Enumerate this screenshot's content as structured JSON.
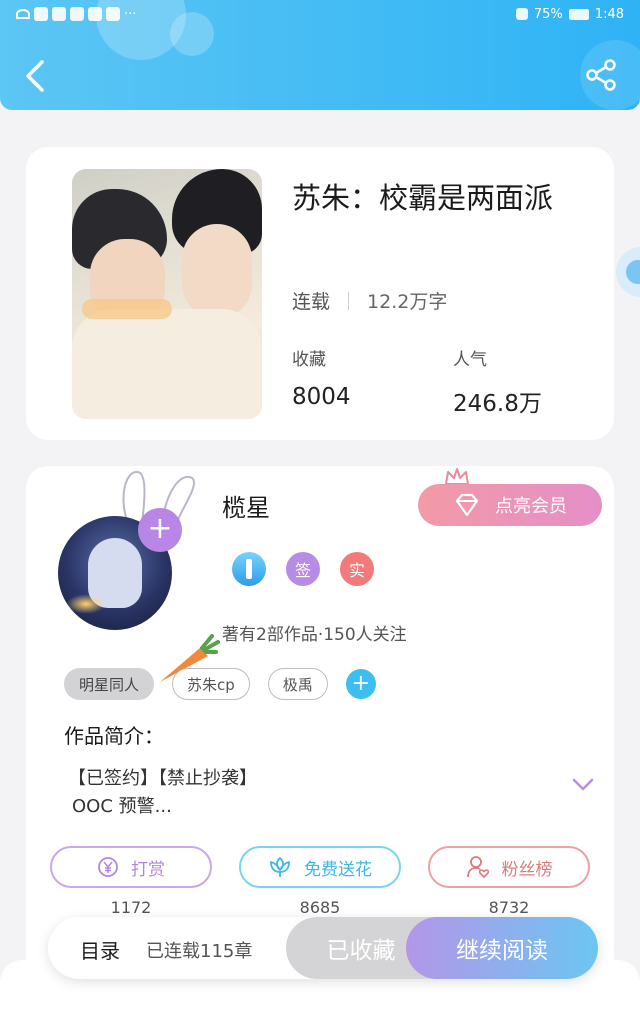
{
  "status_bar": {
    "more": "···",
    "battery": "75%",
    "time": "1:48"
  },
  "book": {
    "title": "苏朱：校霸是两面派",
    "state": "连载",
    "word_count": "12.2万字",
    "favorites_label": "收藏",
    "favorites_value": "8004",
    "popularity_label": "人气",
    "popularity_value": "246.8万"
  },
  "author": {
    "name": "榄星",
    "vip_label": "点亮会员",
    "badge_sign": "签",
    "badge_real": "实",
    "works_info": "著有2部作品·150人关注",
    "tags": [
      "明星同人",
      "苏朱cp",
      "极禹"
    ]
  },
  "intro": {
    "title": "作品简介：",
    "line1": "【已签约】【禁止抄袭】",
    "line2": "OOC 预警..."
  },
  "actions": {
    "reward_label": "打赏",
    "reward_count": "1172",
    "flower_label": "免费送花",
    "flower_count": "8685",
    "fans_label": "粉丝榜",
    "fans_count": "8732"
  },
  "bottom_bar": {
    "toc": "目录",
    "chapters": "已连载115章",
    "collected": "已收藏",
    "continue": "继续阅读"
  },
  "colors": {
    "header_start": "#5cc6f4",
    "header_end": "#2fb3f5",
    "purple": "#b887e6",
    "cyan": "#3dbef1",
    "pink": "#f39aa6"
  }
}
